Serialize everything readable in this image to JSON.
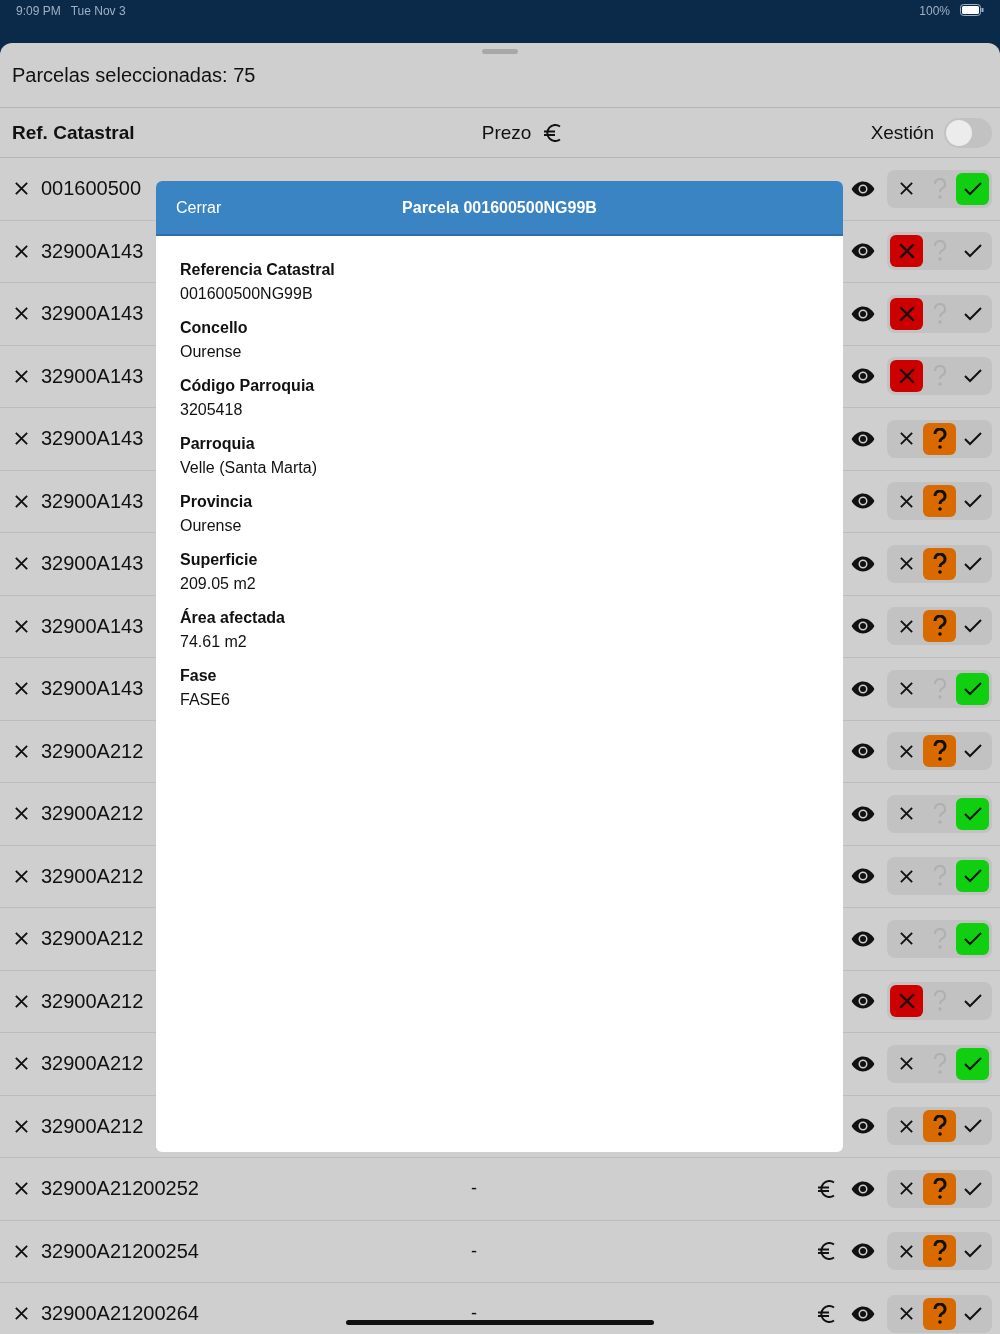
{
  "status_bar": {
    "time": "9:09 PM",
    "date": "Tue Nov 3",
    "battery": "100%"
  },
  "sheet": {
    "title": "Parcelas seleccionadas: 75"
  },
  "columns": {
    "ref": "Ref. Catastral",
    "price": "Prezo",
    "management": "Xestión",
    "management_on": false
  },
  "rows": [
    {
      "ref": "001600500",
      "choices": [
        {
          "kind": "reject",
          "selected": false
        },
        {
          "kind": "maybe",
          "selected": false
        },
        {
          "kind": "accept",
          "selected": true
        }
      ]
    },
    {
      "ref": "32900A143",
      "choices": [
        {
          "kind": "reject",
          "selected": true
        },
        {
          "kind": "maybe",
          "selected": false
        },
        {
          "kind": "accept",
          "selected": false
        }
      ]
    },
    {
      "ref": "32900A143",
      "choices": [
        {
          "kind": "reject",
          "selected": true
        },
        {
          "kind": "maybe",
          "selected": false
        },
        {
          "kind": "accept",
          "selected": false
        }
      ]
    },
    {
      "ref": "32900A143",
      "choices": [
        {
          "kind": "reject",
          "selected": true
        },
        {
          "kind": "maybe",
          "selected": false
        },
        {
          "kind": "accept",
          "selected": false
        }
      ]
    },
    {
      "ref": "32900A143",
      "choices": [
        {
          "kind": "reject",
          "selected": false
        },
        {
          "kind": "maybe",
          "selected": true
        },
        {
          "kind": "accept",
          "selected": false
        }
      ]
    },
    {
      "ref": "32900A143",
      "choices": [
        {
          "kind": "reject",
          "selected": false
        },
        {
          "kind": "maybe",
          "selected": true
        },
        {
          "kind": "accept",
          "selected": false
        }
      ]
    },
    {
      "ref": "32900A143",
      "choices": [
        {
          "kind": "reject",
          "selected": false
        },
        {
          "kind": "maybe",
          "selected": true
        },
        {
          "kind": "accept",
          "selected": false
        }
      ]
    },
    {
      "ref": "32900A143",
      "choices": [
        {
          "kind": "reject",
          "selected": false
        },
        {
          "kind": "maybe",
          "selected": true
        },
        {
          "kind": "accept",
          "selected": false
        }
      ]
    },
    {
      "ref": "32900A143",
      "choices": [
        {
          "kind": "reject",
          "selected": false
        },
        {
          "kind": "maybe",
          "selected": false
        },
        {
          "kind": "accept",
          "selected": true
        }
      ]
    },
    {
      "ref": "32900A212",
      "choices": [
        {
          "kind": "reject",
          "selected": false
        },
        {
          "kind": "maybe",
          "selected": true
        },
        {
          "kind": "accept",
          "selected": false
        }
      ]
    },
    {
      "ref": "32900A212",
      "choices": [
        {
          "kind": "reject",
          "selected": false
        },
        {
          "kind": "maybe",
          "selected": false
        },
        {
          "kind": "accept",
          "selected": true
        }
      ]
    },
    {
      "ref": "32900A212",
      "choices": [
        {
          "kind": "reject",
          "selected": false
        },
        {
          "kind": "maybe",
          "selected": false
        },
        {
          "kind": "accept",
          "selected": true
        }
      ]
    },
    {
      "ref": "32900A212",
      "choices": [
        {
          "kind": "reject",
          "selected": false
        },
        {
          "kind": "maybe",
          "selected": false
        },
        {
          "kind": "accept",
          "selected": true
        }
      ]
    },
    {
      "ref": "32900A212",
      "choices": [
        {
          "kind": "reject",
          "selected": true
        },
        {
          "kind": "maybe",
          "selected": false
        },
        {
          "kind": "accept",
          "selected": false
        }
      ]
    },
    {
      "ref": "32900A212",
      "choices": [
        {
          "kind": "reject",
          "selected": false
        },
        {
          "kind": "maybe",
          "selected": false
        },
        {
          "kind": "accept",
          "selected": true
        }
      ]
    },
    {
      "ref": "32900A212",
      "choices": [
        {
          "kind": "reject",
          "selected": false
        },
        {
          "kind": "maybe",
          "selected": true
        },
        {
          "kind": "accept",
          "selected": false
        }
      ]
    },
    {
      "ref": "32900A21200252",
      "price": "-",
      "choices": [
        {
          "kind": "reject",
          "selected": false
        },
        {
          "kind": "maybe",
          "selected": true
        },
        {
          "kind": "accept",
          "selected": false
        }
      ]
    },
    {
      "ref": "32900A21200254",
      "price": "-",
      "choices": [
        {
          "kind": "reject",
          "selected": false
        },
        {
          "kind": "maybe",
          "selected": true
        },
        {
          "kind": "accept",
          "selected": false
        }
      ]
    },
    {
      "ref": "32900A21200264",
      "price": "-",
      "choices": [
        {
          "kind": "reject",
          "selected": false
        },
        {
          "kind": "maybe",
          "selected": true
        },
        {
          "kind": "accept",
          "selected": false
        }
      ]
    }
  ],
  "modal": {
    "close": "Cerrar",
    "title": "Parcela 001600500NG99B",
    "fields": [
      {
        "label": "Referencia Catastral",
        "value": "001600500NG99B"
      },
      {
        "label": "Concello",
        "value": "Ourense"
      },
      {
        "label": "Código Parroquia",
        "value": "3205418"
      },
      {
        "label": "Parroquia",
        "value": "Velle (Santa Marta)"
      },
      {
        "label": "Provincia",
        "value": "Ourense"
      },
      {
        "label": "Superficie",
        "value": "209.05 m2"
      },
      {
        "label": "Área afectada",
        "value": "74.61 m2"
      },
      {
        "label": "Fase",
        "value": "FASE6"
      }
    ]
  }
}
